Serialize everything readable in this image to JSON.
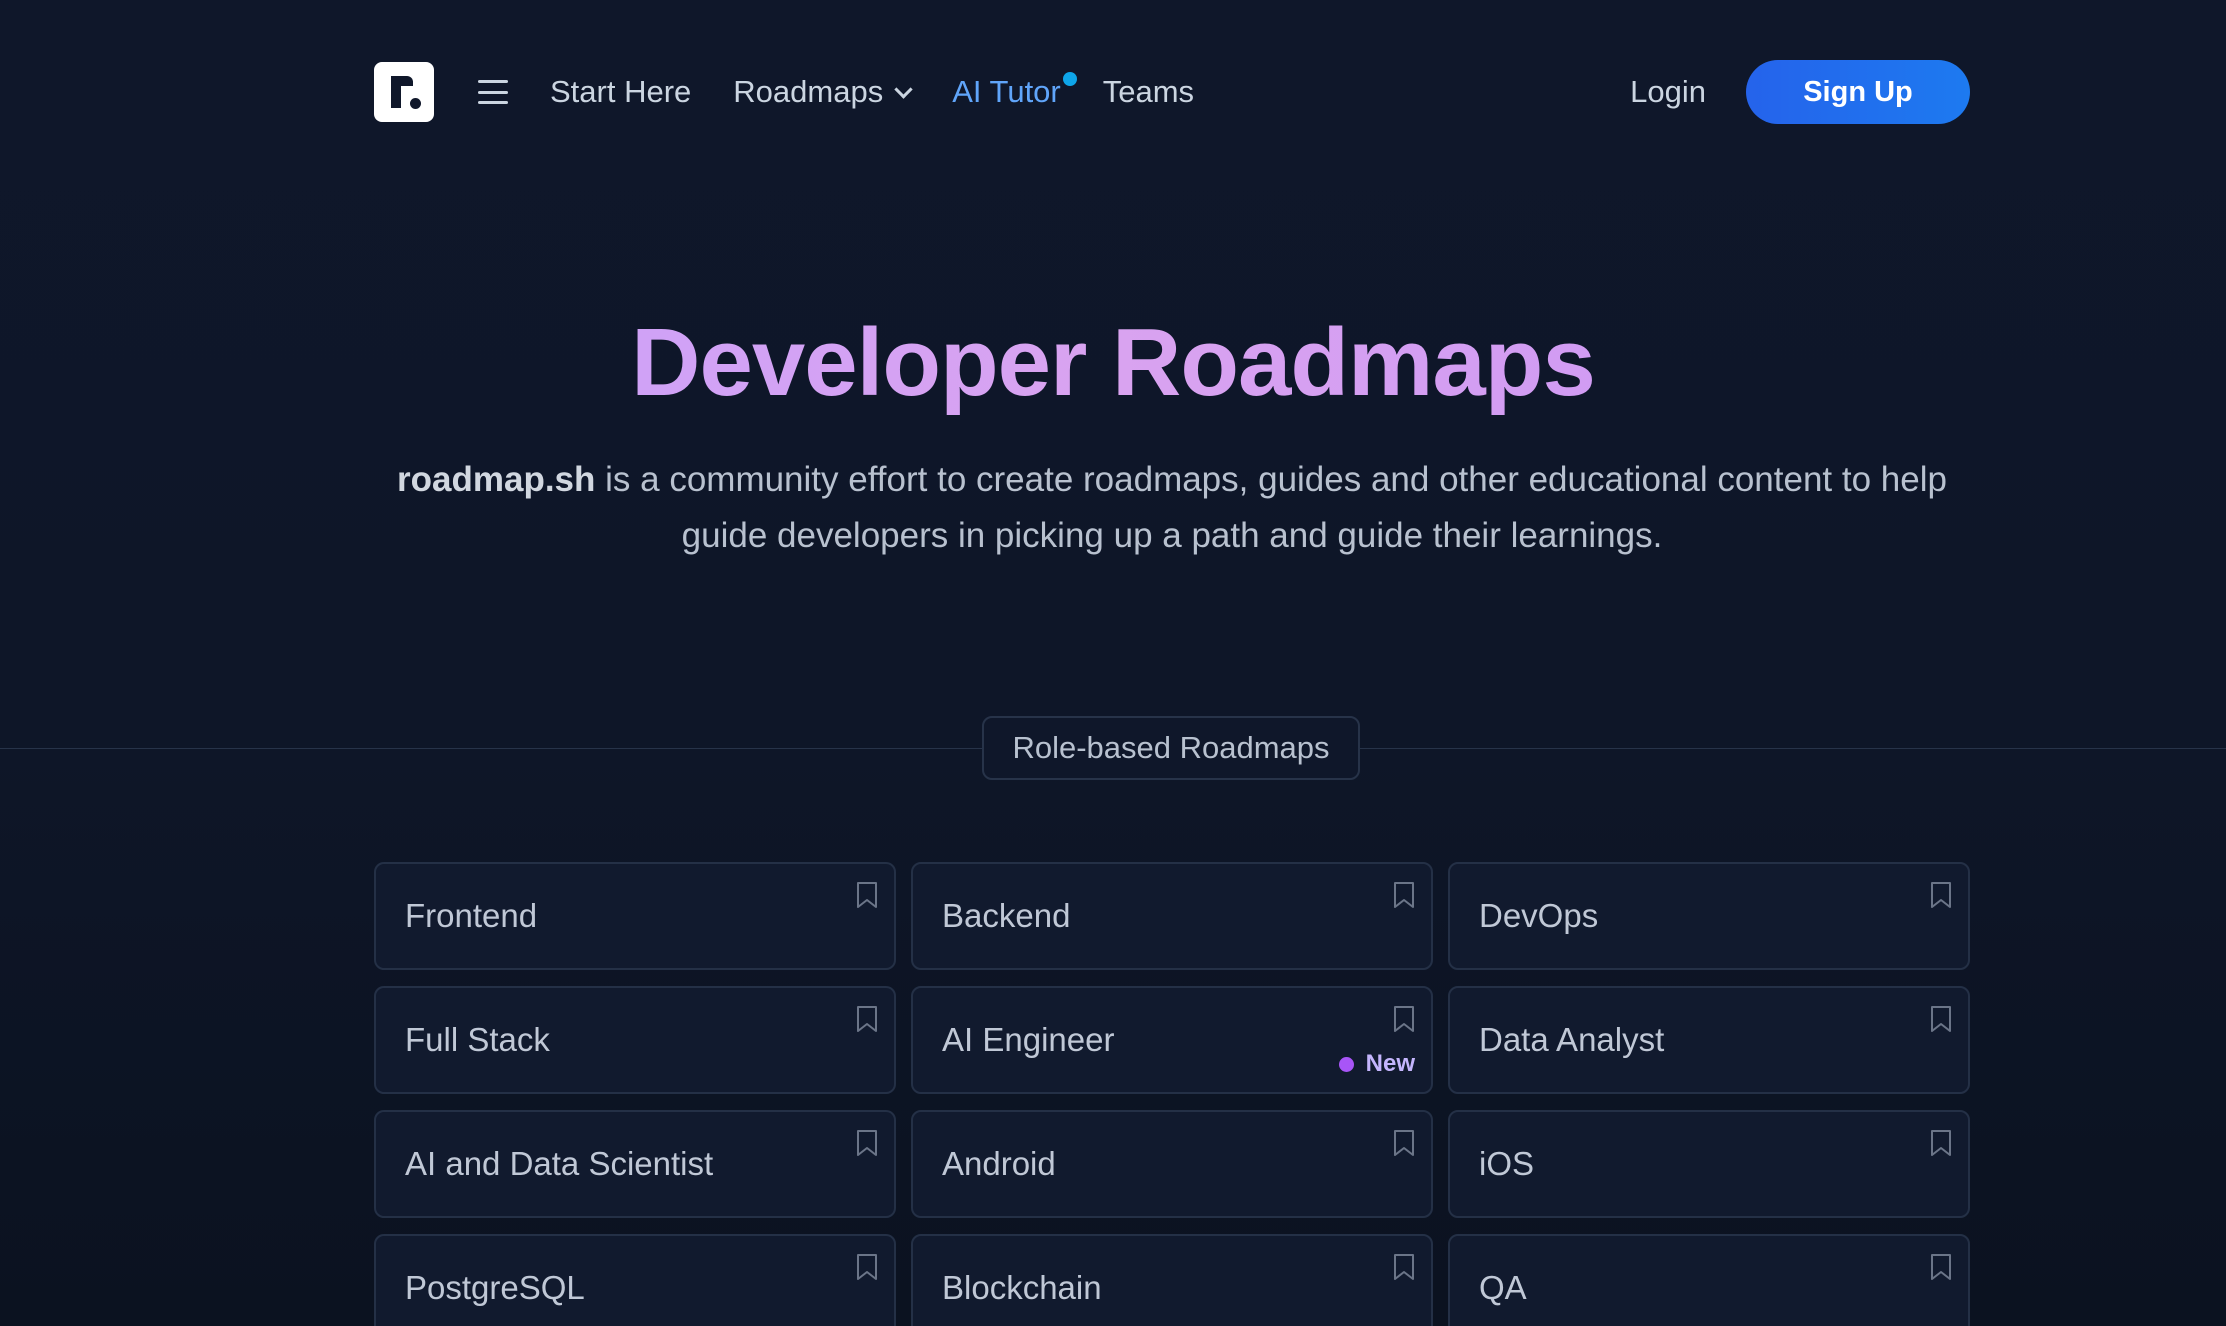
{
  "nav": {
    "links": {
      "start_here": "Start Here",
      "roadmaps": "Roadmaps",
      "ai_tutor": "AI Tutor",
      "teams": "Teams"
    },
    "login": "Login",
    "signup": "Sign Up",
    "ai_tutor_dot_color": "#0ea5e9"
  },
  "hero": {
    "title": "Developer Roadmaps",
    "brand": "roadmap.sh",
    "description": " is a community effort to create roadmaps, guides and other educational content to help guide developers in picking up a path and guide their learnings."
  },
  "section": {
    "label": "Role-based Roadmaps"
  },
  "roadmaps": [
    {
      "title": "Frontend"
    },
    {
      "title": "Backend"
    },
    {
      "title": "DevOps"
    },
    {
      "title": "Full Stack"
    },
    {
      "title": "AI Engineer",
      "badge": "New"
    },
    {
      "title": "Data Analyst"
    },
    {
      "title": "AI and Data Scientist"
    },
    {
      "title": "Android"
    },
    {
      "title": "iOS"
    },
    {
      "title": "PostgreSQL"
    },
    {
      "title": "Blockchain"
    },
    {
      "title": "QA"
    }
  ],
  "colors": {
    "accent": "#2563eb",
    "title_gradient": "#d6a0f5",
    "badge_dot": "#a855f7"
  }
}
